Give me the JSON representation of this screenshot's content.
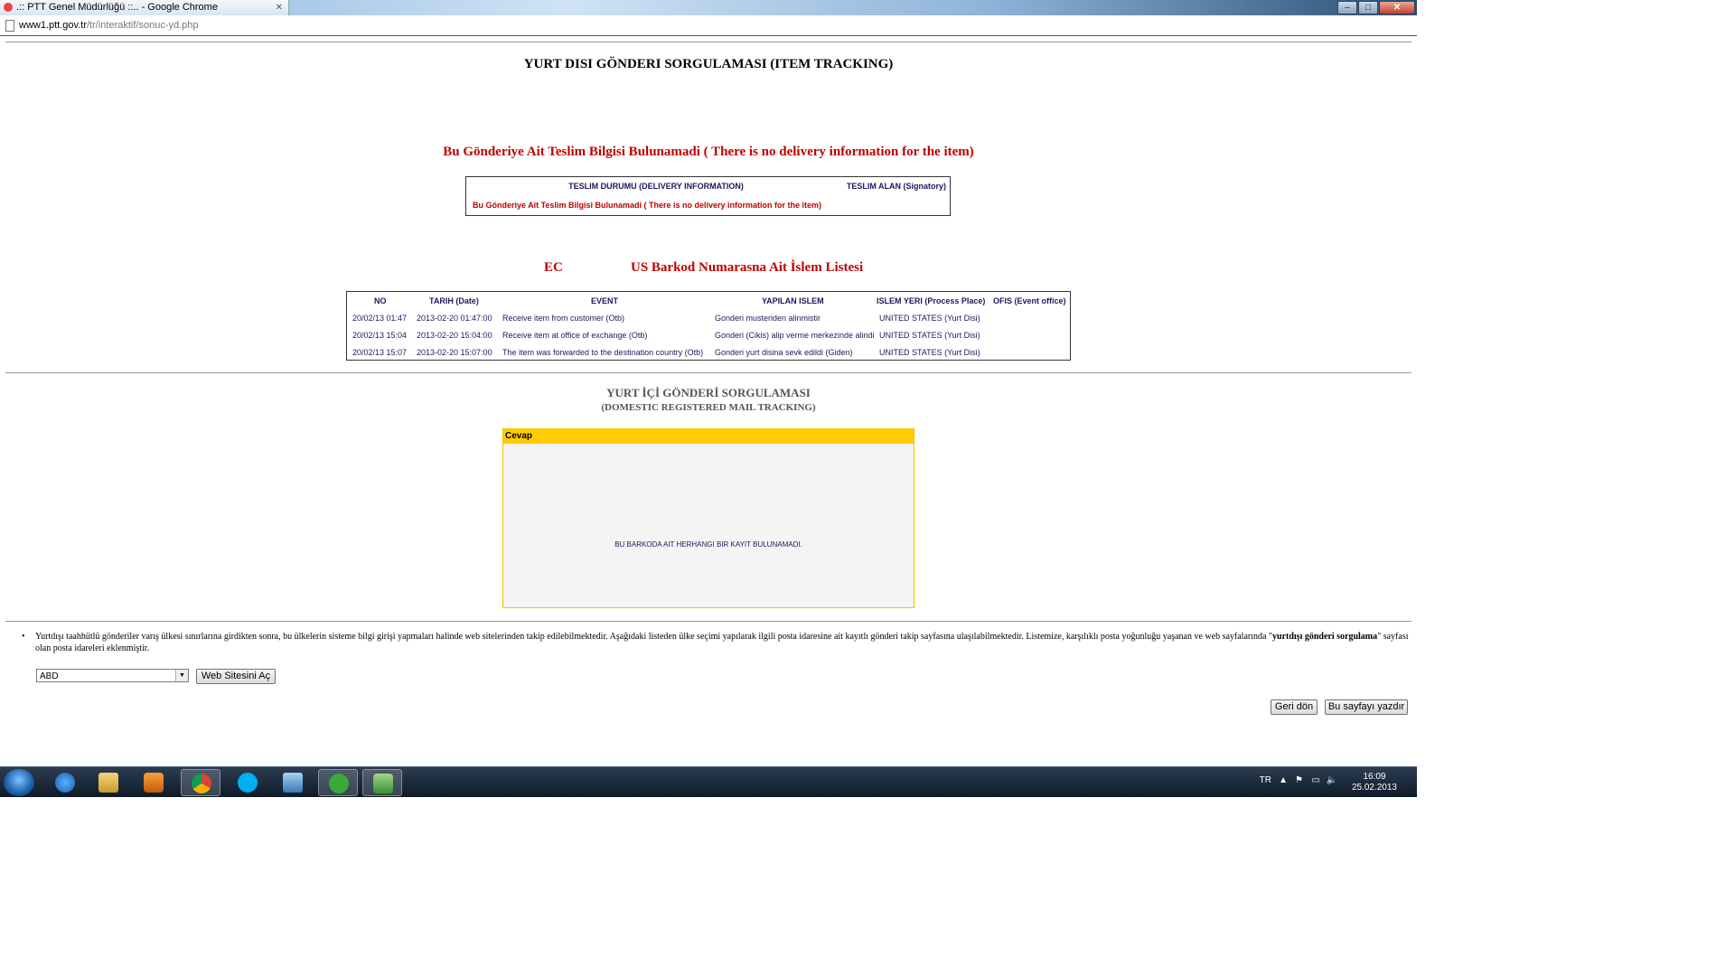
{
  "window": {
    "tab_title": ".:: PTT Genel Müdürlüğü ::.. - Google Chrome"
  },
  "address_bar": {
    "host": "www1.ptt.gov.tr",
    "path": "/tr/interaktif/sonuc-yd.php"
  },
  "page": {
    "main_title": "YURT DISI GÖNDERI SORGULAMASI (ITEM TRACKING)",
    "no_delivery_heading": "Bu Gönderiye Ait Teslim Bilgisi Bulunamadi ( There is no delivery information for the item)",
    "delivery_box": {
      "col1_header": "TESLIM DURUMU (DELIVERY INFORMATION)",
      "col2_header": "TESLIM ALAN (Signatory)",
      "message": "Bu Gönderiye Ait Teslim Bilgisi Bulunamadi ( There is no delivery information for the item)"
    },
    "barcode_prefix": "EC",
    "barcode_heading": "US Barkod Numarasna Ait İslem Listesi",
    "events": {
      "headers": [
        "NO",
        "TARIH (Date)",
        "EVENT",
        "YAPILAN ISLEM",
        "ISLEM YERI (Process Place)",
        "OFIS (Event office)"
      ],
      "rows": [
        [
          "20/02/13 01:47",
          "2013-02-20 01:47:00",
          "Receive item from customer (Otb)",
          "Gonderi musteriden alinmistir",
          "UNITED STATES (Yurt Disi)",
          ""
        ],
        [
          "20/02/13 15:04",
          "2013-02-20 15:04:00",
          "Receive item at office of exchange (Otb)",
          "Gonderi (Cikis) alip verme merkezinde alindi",
          "UNITED STATES (Yurt Disi)",
          ""
        ],
        [
          "20/02/13 15:07",
          "2013-02-20 15:07:00",
          "The item was forwarded to the destination country (Otb)",
          "Gonderi yurt disina sevk edildi (Giden)",
          "UNITED STATES (Yurt Disi)",
          ""
        ]
      ]
    },
    "domestic_title": "YURT İÇİ GÖNDERİ SORGULAMASI",
    "domestic_subtitle": "(DOMESTIC REGISTERED MAIL TRACKING)",
    "answer_box": {
      "header": "Cevap",
      "message": "BU BARKODA AIT HERHANGI BIR KAYIT BULUNAMADI."
    },
    "note": {
      "text_before_bold": "Yurtdışı taahhütlü gönderiler varış ülkesi sınırlarına girdikten sonra, bu ülkelerin sisteme bilgi girişi yapmaları halinde web sitelerinden takip edilebilmektedir. Aşağıdaki listeden ülke seçimi yapılarak ilgili posta idaresine ait  kayıtlı gönderi takip  sayfasına ulaşılabilmektedir. Listemize, karşılıklı posta yoğunluğu yaşanan ve web sayfalarında \"",
      "bold": "yurtdışı gönderi sorgulama",
      "text_after_bold": "\" sayfası olan posta idareleri eklenmiştir."
    },
    "country_select": {
      "selected": "ABD"
    },
    "open_site_button": "Web Sitesini Aç",
    "back_button": "Geri dön",
    "print_button": "Bu sayfayı yazdır"
  },
  "taskbar": {
    "apps": [
      "internet-explorer",
      "file-explorer",
      "media-player",
      "chrome",
      "skype",
      "remote-desktop",
      "utorrent",
      "users"
    ],
    "language": "TR",
    "time": "16:09",
    "date": "25.02.2013"
  }
}
